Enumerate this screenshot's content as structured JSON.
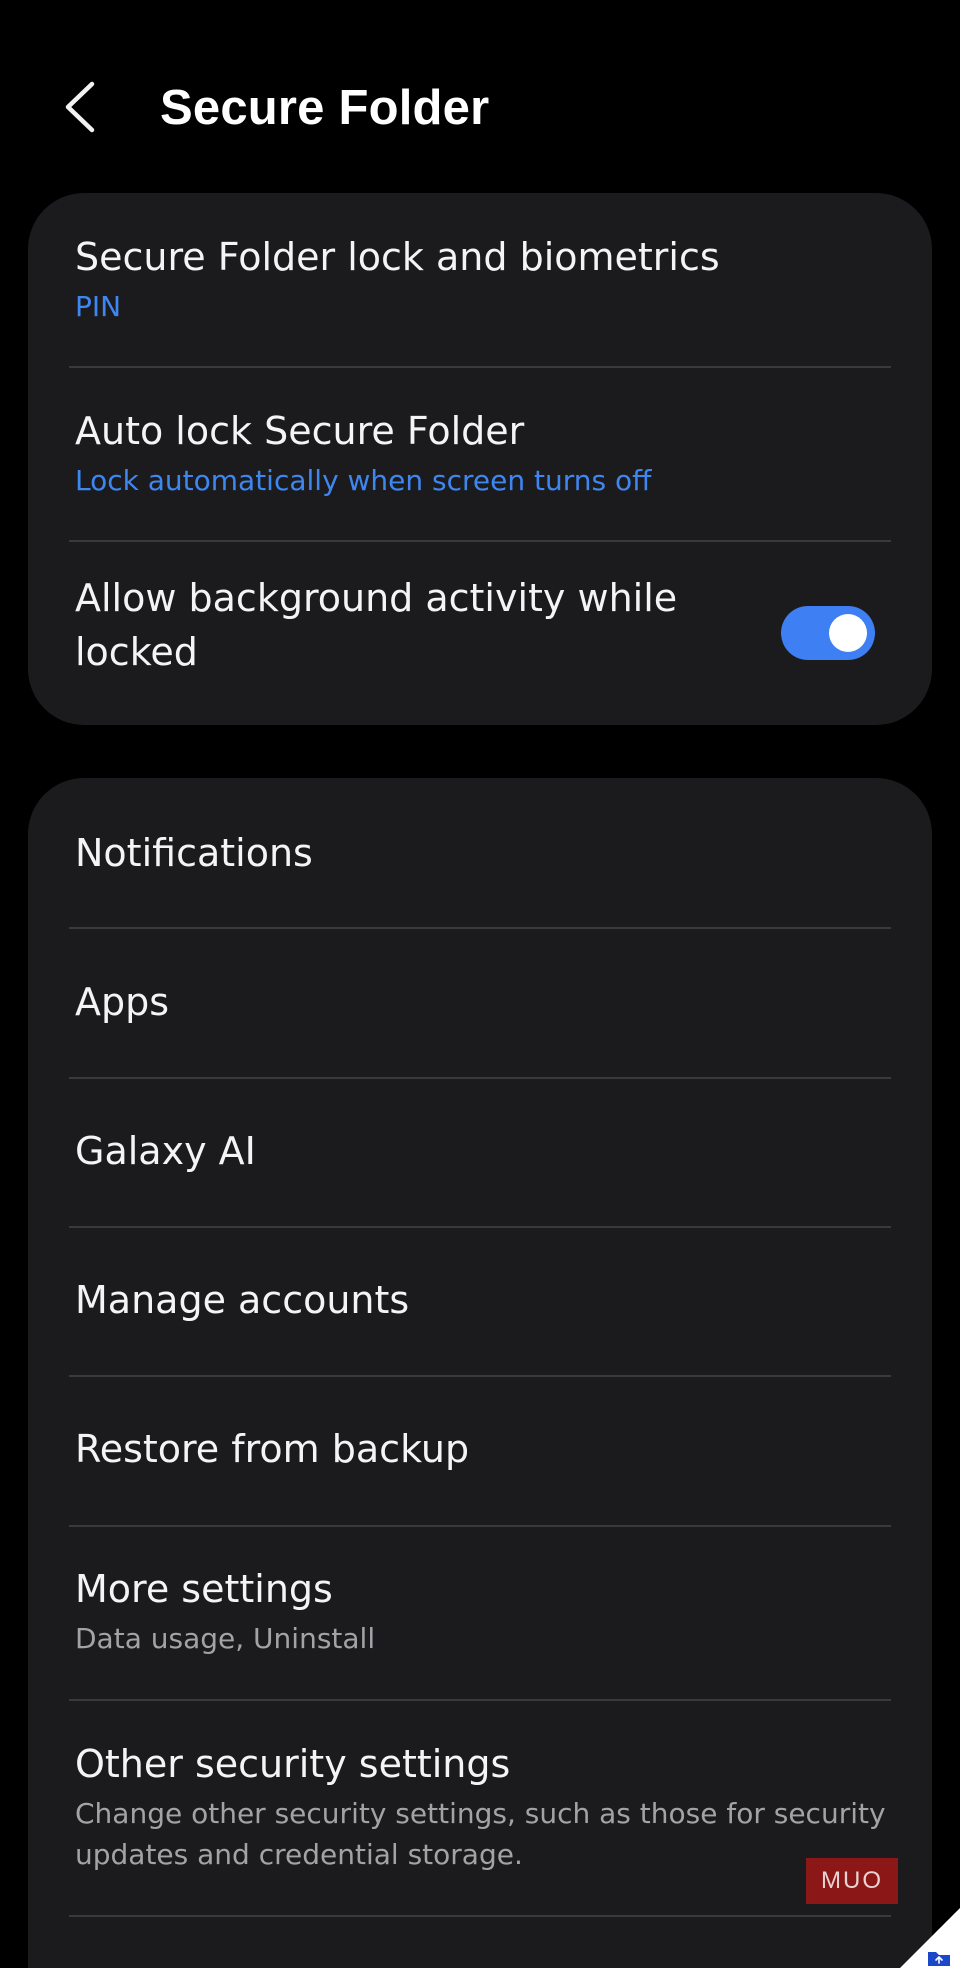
{
  "header": {
    "title": "Secure Folder"
  },
  "lock_card": {
    "items": [
      {
        "title": "Secure Folder lock and biometrics",
        "subtitle": "PIN"
      },
      {
        "title": "Auto lock Secure Folder",
        "subtitle": "Lock automatically when screen turns off"
      },
      {
        "title_line1": "Allow background activity while",
        "title_line2": "locked",
        "toggle_on": true
      }
    ]
  },
  "settings_card": {
    "items": [
      {
        "title": "Notifications"
      },
      {
        "title": "Apps"
      },
      {
        "title": "Galaxy AI"
      },
      {
        "title": "Manage accounts"
      },
      {
        "title": "Restore from backup"
      },
      {
        "title": "More settings",
        "subtitle": "Data usage, Uninstall"
      },
      {
        "title": "Other security settings",
        "subtitle_line1": "Change other security settings, such as those for security",
        "subtitle_line2": "updates and credential storage."
      }
    ]
  },
  "watermark": {
    "text": "MUO"
  },
  "colors": {
    "background": "#000000",
    "card": "#1b1b1d",
    "accent": "#3e86f0",
    "toggle": "#3e7ff3",
    "muted_text": "#a3a3a6",
    "divider": "#3a3a3c"
  },
  "icons": {
    "back": "chevron-left-icon",
    "corner": "folder-upload-icon"
  }
}
